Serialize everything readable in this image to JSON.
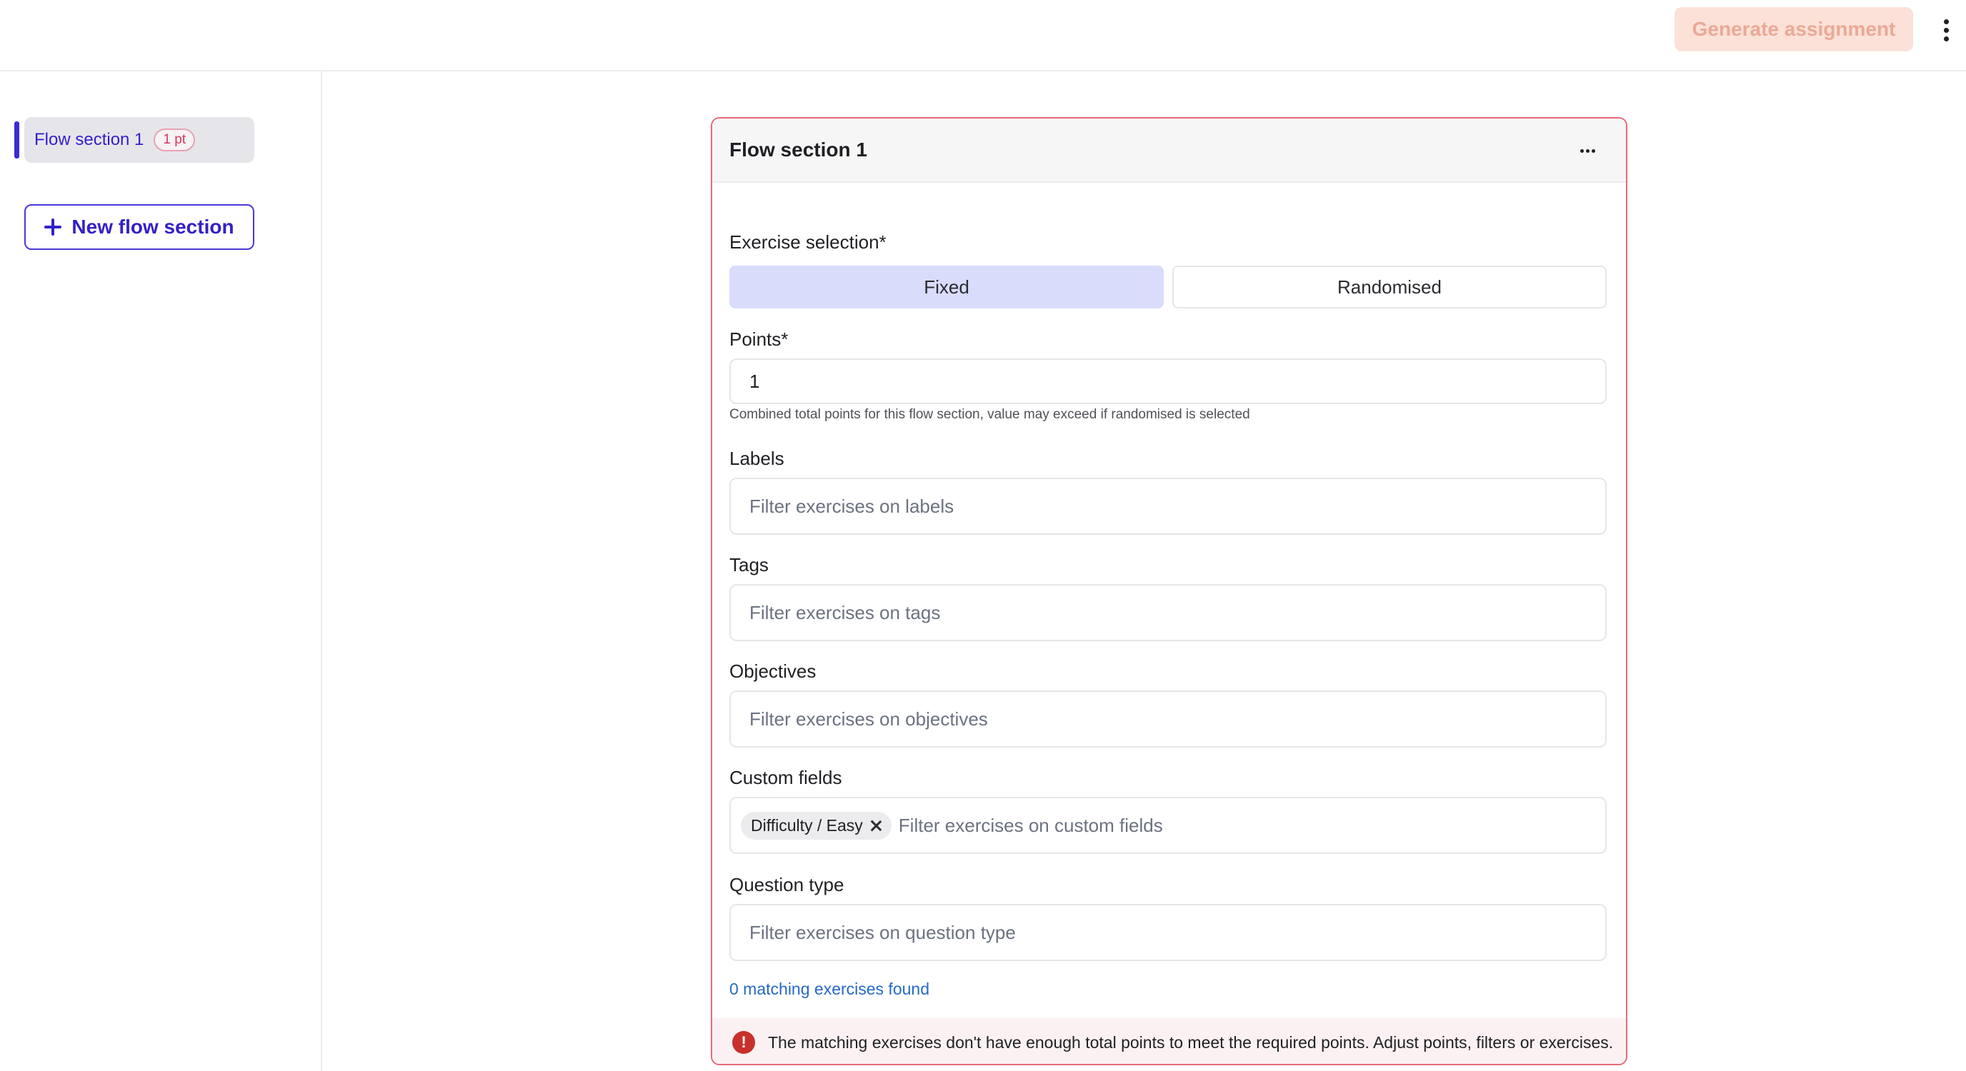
{
  "header": {
    "generate_label": "Generate assignment"
  },
  "sidebar": {
    "items": [
      {
        "label": "Flow section 1",
        "badge": "1 pt"
      }
    ],
    "new_section_label": "New flow section"
  },
  "section": {
    "title": "Flow section 1",
    "exercise_selection": {
      "label": "Exercise selection*",
      "options": [
        "Fixed",
        "Randomised"
      ],
      "selected": "Fixed"
    },
    "points": {
      "label": "Points*",
      "value": "1",
      "hint": "Combined total points for this flow section, value may exceed if randomised is selected"
    },
    "labels": {
      "label": "Labels",
      "placeholder": "Filter exercises on labels"
    },
    "tags": {
      "label": "Tags",
      "placeholder": "Filter exercises on tags"
    },
    "objectives": {
      "label": "Objectives",
      "placeholder": "Filter exercises on objectives"
    },
    "custom_fields": {
      "label": "Custom fields",
      "chips": [
        "Difficulty / Easy"
      ],
      "placeholder": "Filter exercises on custom fields"
    },
    "question_type": {
      "label": "Question type",
      "placeholder": "Filter exercises on question type"
    },
    "matching_text": "0 matching exercises found",
    "error_text": "The matching exercises don't have enough total points to meet the required points. Adjust points, filters or exercises."
  },
  "colors": {
    "accent": "#3221c9",
    "error": "#c8302c",
    "card_border": "#e6697a",
    "generate_bg": "#fbe1d8",
    "selected_segment": "#d9dcfb"
  }
}
